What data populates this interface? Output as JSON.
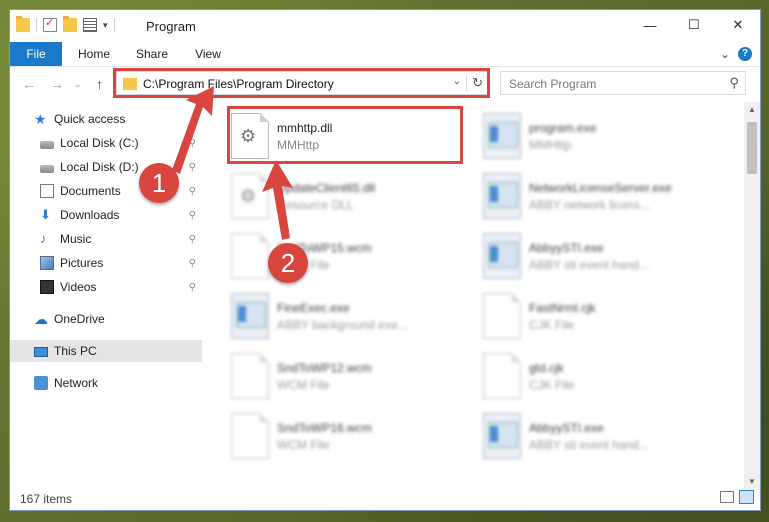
{
  "window": {
    "title": "Program",
    "controls": {
      "minimize": "—",
      "maximize": "☐",
      "close": "✕"
    }
  },
  "ribbon": {
    "tabs": [
      "File",
      "Home",
      "Share",
      "View"
    ],
    "expand_glyph": "⌄",
    "help_glyph": "?"
  },
  "navigation": {
    "back": "←",
    "forward": "→",
    "recent": "⌄",
    "up": "↑",
    "address": "C:\\Program Files\\Program Directory",
    "address_drop": "⌄",
    "refresh": "↻",
    "search_placeholder": "Search Program",
    "search_icon": "⚲"
  },
  "sidebar": {
    "items": [
      {
        "label": "Quick access",
        "icon": "star-icon",
        "pinned": false
      },
      {
        "label": "Local Disk (C:)",
        "icon": "disk-icon",
        "pinned": true
      },
      {
        "label": "Local Disk (D:)",
        "icon": "disk-icon",
        "pinned": true
      },
      {
        "label": "Documents",
        "icon": "documents-icon",
        "pinned": true
      },
      {
        "label": "Downloads",
        "icon": "download-icon",
        "pinned": true
      },
      {
        "label": "Music",
        "icon": "music-icon",
        "pinned": true
      },
      {
        "label": "Pictures",
        "icon": "pictures-icon",
        "pinned": true
      },
      {
        "label": "Videos",
        "icon": "videos-icon",
        "pinned": true
      },
      {
        "label": "OneDrive",
        "icon": "cloud-icon",
        "pinned": false
      },
      {
        "label": "This PC",
        "icon": "computer-icon",
        "pinned": false,
        "selected": true
      },
      {
        "label": "Network",
        "icon": "network-icon",
        "pinned": false
      }
    ],
    "pin_glyph": "📌"
  },
  "files": [
    {
      "name": "mmhttp.dll",
      "desc": "MMHttp",
      "type": "dll"
    },
    {
      "name": "program.exe",
      "desc": "MMHttp",
      "type": "exe"
    },
    {
      "name": "UpdateClient65.dll",
      "desc": "Resource DLL",
      "type": "dll"
    },
    {
      "name": "NetworkLicenseServer.exe",
      "desc": "ABBY network licens...",
      "type": "exe"
    },
    {
      "name": "SndToWP15.wcm",
      "desc": "WCM File",
      "type": "doc"
    },
    {
      "name": "AbbyySTI.exe",
      "desc": "ABBY sti event hand...",
      "type": "exe"
    },
    {
      "name": "FineExec.exe",
      "desc": "ABBY background exe...",
      "type": "exe"
    },
    {
      "name": "FastNrml.cjk",
      "desc": "CJK File",
      "type": "doc"
    },
    {
      "name": "SndToWP12.wcm",
      "desc": "WCM File",
      "type": "doc"
    },
    {
      "name": "gtd.cjk",
      "desc": "CJK File",
      "type": "doc"
    },
    {
      "name": "SndToWP16.wcm",
      "desc": "WCM File",
      "type": "doc"
    },
    {
      "name": "AbbyySTI.exe",
      "desc": "ABBY sti event hand...",
      "type": "exe"
    }
  ],
  "status": {
    "item_count": "167 items"
  },
  "annotations": {
    "step1": "1",
    "step2": "2",
    "color": "#d8463f"
  }
}
